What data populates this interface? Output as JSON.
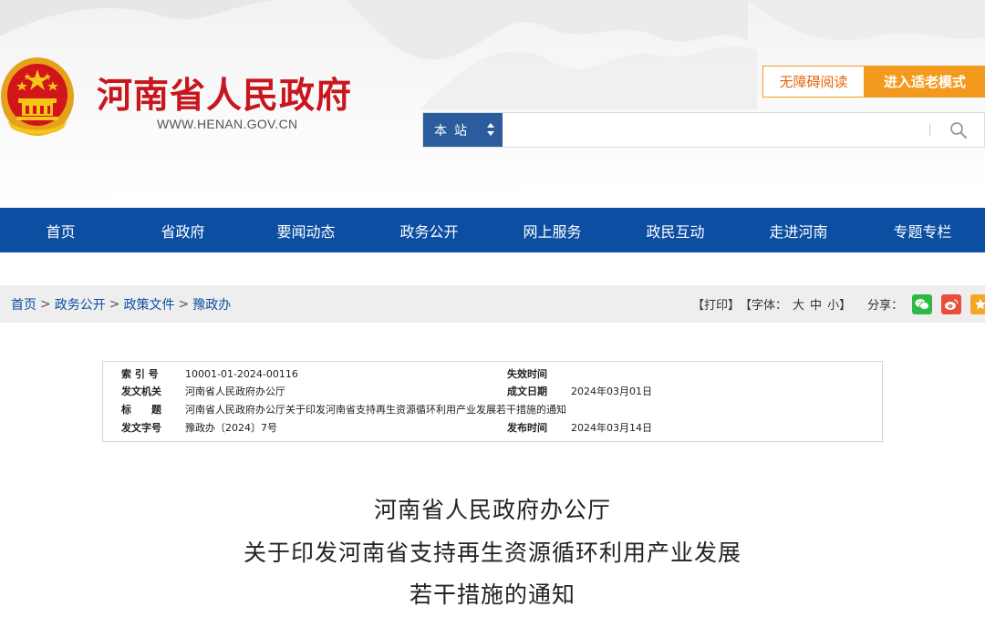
{
  "header": {
    "site_title": "河南省人民政府",
    "site_url": "WWW.HENAN.GOV.CN",
    "accessibility_label": "无障碍阅读",
    "elder_mode_label": "进入适老模式",
    "search": {
      "scope_label": "本站",
      "placeholder": ""
    },
    "colors": {
      "brand_red": "#c8161e",
      "nav_blue": "#0b4ea2",
      "accent_orange": "#f39a1e"
    }
  },
  "nav": {
    "items": [
      {
        "label": "首页"
      },
      {
        "label": "省政府"
      },
      {
        "label": "要闻动态"
      },
      {
        "label": "政务公开"
      },
      {
        "label": "网上服务"
      },
      {
        "label": "政民互动"
      },
      {
        "label": "走进河南"
      },
      {
        "label": "专题专栏"
      }
    ]
  },
  "breadcrumb": {
    "items": [
      "首页",
      "政务公开",
      "政策文件",
      "豫政办"
    ],
    "separator": ">"
  },
  "tools": {
    "print": "【打印】",
    "font_prefix": "【字体：",
    "font_large": "大",
    "font_medium": "中",
    "font_small": "小",
    "font_suffix": "】",
    "share_label": "分享：",
    "share_icons": [
      "wechat-icon",
      "weibo-icon",
      "favorite-icon"
    ]
  },
  "info": {
    "index_label": "索 引 号",
    "index_value": "10001-01-2024-00116",
    "expiry_label": "失效时间",
    "expiry_value": "",
    "issuer_label": "发文机关",
    "issuer_value": "河南省人民政府办公厅",
    "date_label": "成文日期",
    "date_value": "2024年03月01日",
    "title_label": "标　　题",
    "title_value": "河南省人民政府办公厅关于印发河南省支持再生资源循环利用产业发展若干措施的通知",
    "docno_label": "发文字号",
    "docno_value": "豫政办〔2024〕7号",
    "publish_label": "发布时间",
    "publish_value": "2024年03月14日"
  },
  "document": {
    "title_line1": "河南省人民政府办公厅",
    "title_line2": "关于印发河南省支持再生资源循环利用产业发展",
    "title_line3": "若干措施的通知"
  }
}
